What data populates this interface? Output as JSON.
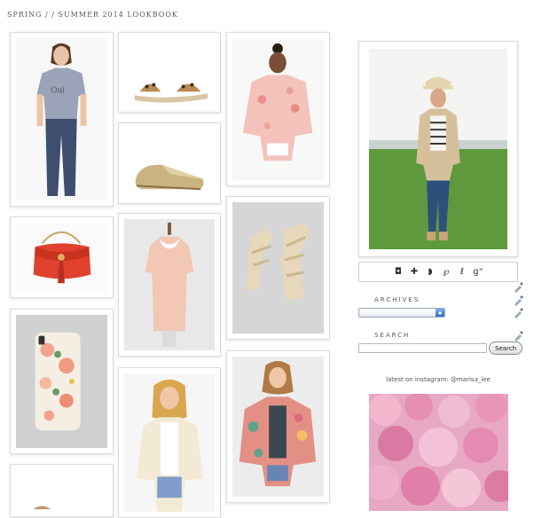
{
  "header": {
    "title": "SPRING / / SUMMER 2014 LOOKBOOK"
  },
  "sidebar": {
    "social_icons": [
      {
        "name": "instagram-icon",
        "glyph": "◘"
      },
      {
        "name": "plus-icon",
        "glyph": "✚"
      },
      {
        "name": "rss-icon",
        "glyph": "◗"
      },
      {
        "name": "pinterest-icon",
        "glyph": "℘"
      },
      {
        "name": "bloglovin-icon",
        "glyph": "ℓ"
      },
      {
        "name": "google-plus-icon",
        "glyph": "g⁺"
      }
    ],
    "archives_heading": "ARCHIVES",
    "search_heading": "SEARCH",
    "search_button": "Search",
    "search_value": "",
    "instagram_caption": "latest on instagram: @marisa_lee"
  }
}
